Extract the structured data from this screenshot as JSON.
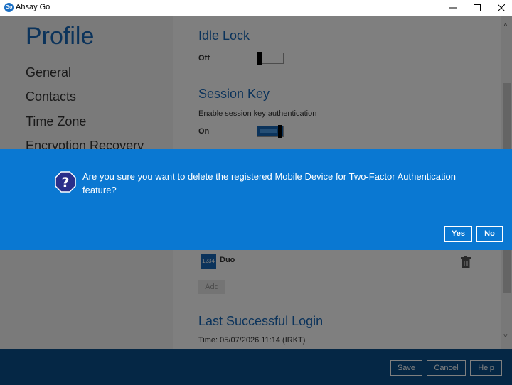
{
  "window": {
    "logo_text": "Go",
    "title": "Ahsay Go"
  },
  "sidebar": {
    "title": "Profile",
    "items": [
      {
        "label": "General"
      },
      {
        "label": "Contacts"
      },
      {
        "label": "Time Zone"
      },
      {
        "label": "Encryption Recovery"
      }
    ]
  },
  "content": {
    "idle_lock": {
      "title": "Idle Lock",
      "state_label": "Off"
    },
    "session_key": {
      "title": "Session Key",
      "description": "Enable session key authentication",
      "state_label": "On"
    },
    "two_factor": {
      "device_code": "1234",
      "device_name": "Duo",
      "add_label": "Add"
    },
    "last_login": {
      "title": "Last Successful Login",
      "time": "Time: 05/07/2026 11:14 (IRKT)"
    }
  },
  "footer": {
    "save_label": "Save",
    "cancel_label": "Cancel",
    "help_label": "Help"
  },
  "dialog": {
    "message": "Are you sure you want to delete the registered Mobile Device for Two-Factor Authentication feature?",
    "yes_label": "Yes",
    "no_label": "No"
  },
  "colors": {
    "accent": "#1766b6",
    "dialog_bg": "#0a78d2",
    "footer_bg": "#0b4f8a"
  }
}
